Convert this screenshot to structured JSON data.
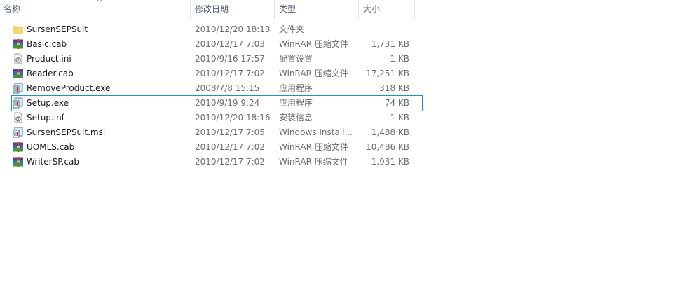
{
  "columns": {
    "name": "名称",
    "date": "修改日期",
    "type": "类型",
    "size": "大小"
  },
  "files": [
    {
      "name": "SursenSEPSuit",
      "date": "2010/12/20 18:13",
      "type": "文件夹",
      "size": "",
      "icon": "folder-icon",
      "selected": false
    },
    {
      "name": "Basic.cab",
      "date": "2010/12/17 7:03",
      "type": "WinRAR 压缩文件",
      "size": "1,731 KB",
      "icon": "winrar-archive-icon",
      "selected": false
    },
    {
      "name": "Product.ini",
      "date": "2010/9/16 17:57",
      "type": "配置设置",
      "size": "1 KB",
      "icon": "settings-file-icon",
      "selected": false
    },
    {
      "name": "Reader.cab",
      "date": "2010/12/17 7:02",
      "type": "WinRAR 压缩文件",
      "size": "17,251 KB",
      "icon": "winrar-archive-icon",
      "selected": false
    },
    {
      "name": "RemoveProduct.exe",
      "date": "2008/7/8 15:15",
      "type": "应用程序",
      "size": "318 KB",
      "icon": "installer-exe-icon",
      "selected": false
    },
    {
      "name": "Setup.exe",
      "date": "2010/9/19 9:24",
      "type": "应用程序",
      "size": "74 KB",
      "icon": "installer-exe-icon",
      "selected": true
    },
    {
      "name": "Setup.inf",
      "date": "2010/12/20 18:16",
      "type": "安装信息",
      "size": "1 KB",
      "icon": "settings-file-icon",
      "selected": false
    },
    {
      "name": "SursenSEPSuit.msi",
      "date": "2010/12/17 7:05",
      "type": "Windows Install...",
      "size": "1,488 KB",
      "icon": "installer-exe-icon",
      "selected": false
    },
    {
      "name": "UOMLS.cab",
      "date": "2010/12/17 7:02",
      "type": "WinRAR 压缩文件",
      "size": "10,486 KB",
      "icon": "winrar-archive-icon",
      "selected": false
    },
    {
      "name": "WriterSP.cab",
      "date": "2010/12/17 7:02",
      "type": "WinRAR 压缩文件",
      "size": "1,931 KB",
      "icon": "winrar-archive-icon",
      "selected": false
    }
  ],
  "colors": {
    "header_text": "#4c607a",
    "selection_border": "#1c8fd6",
    "secondary_text": "#6d6d6d"
  }
}
